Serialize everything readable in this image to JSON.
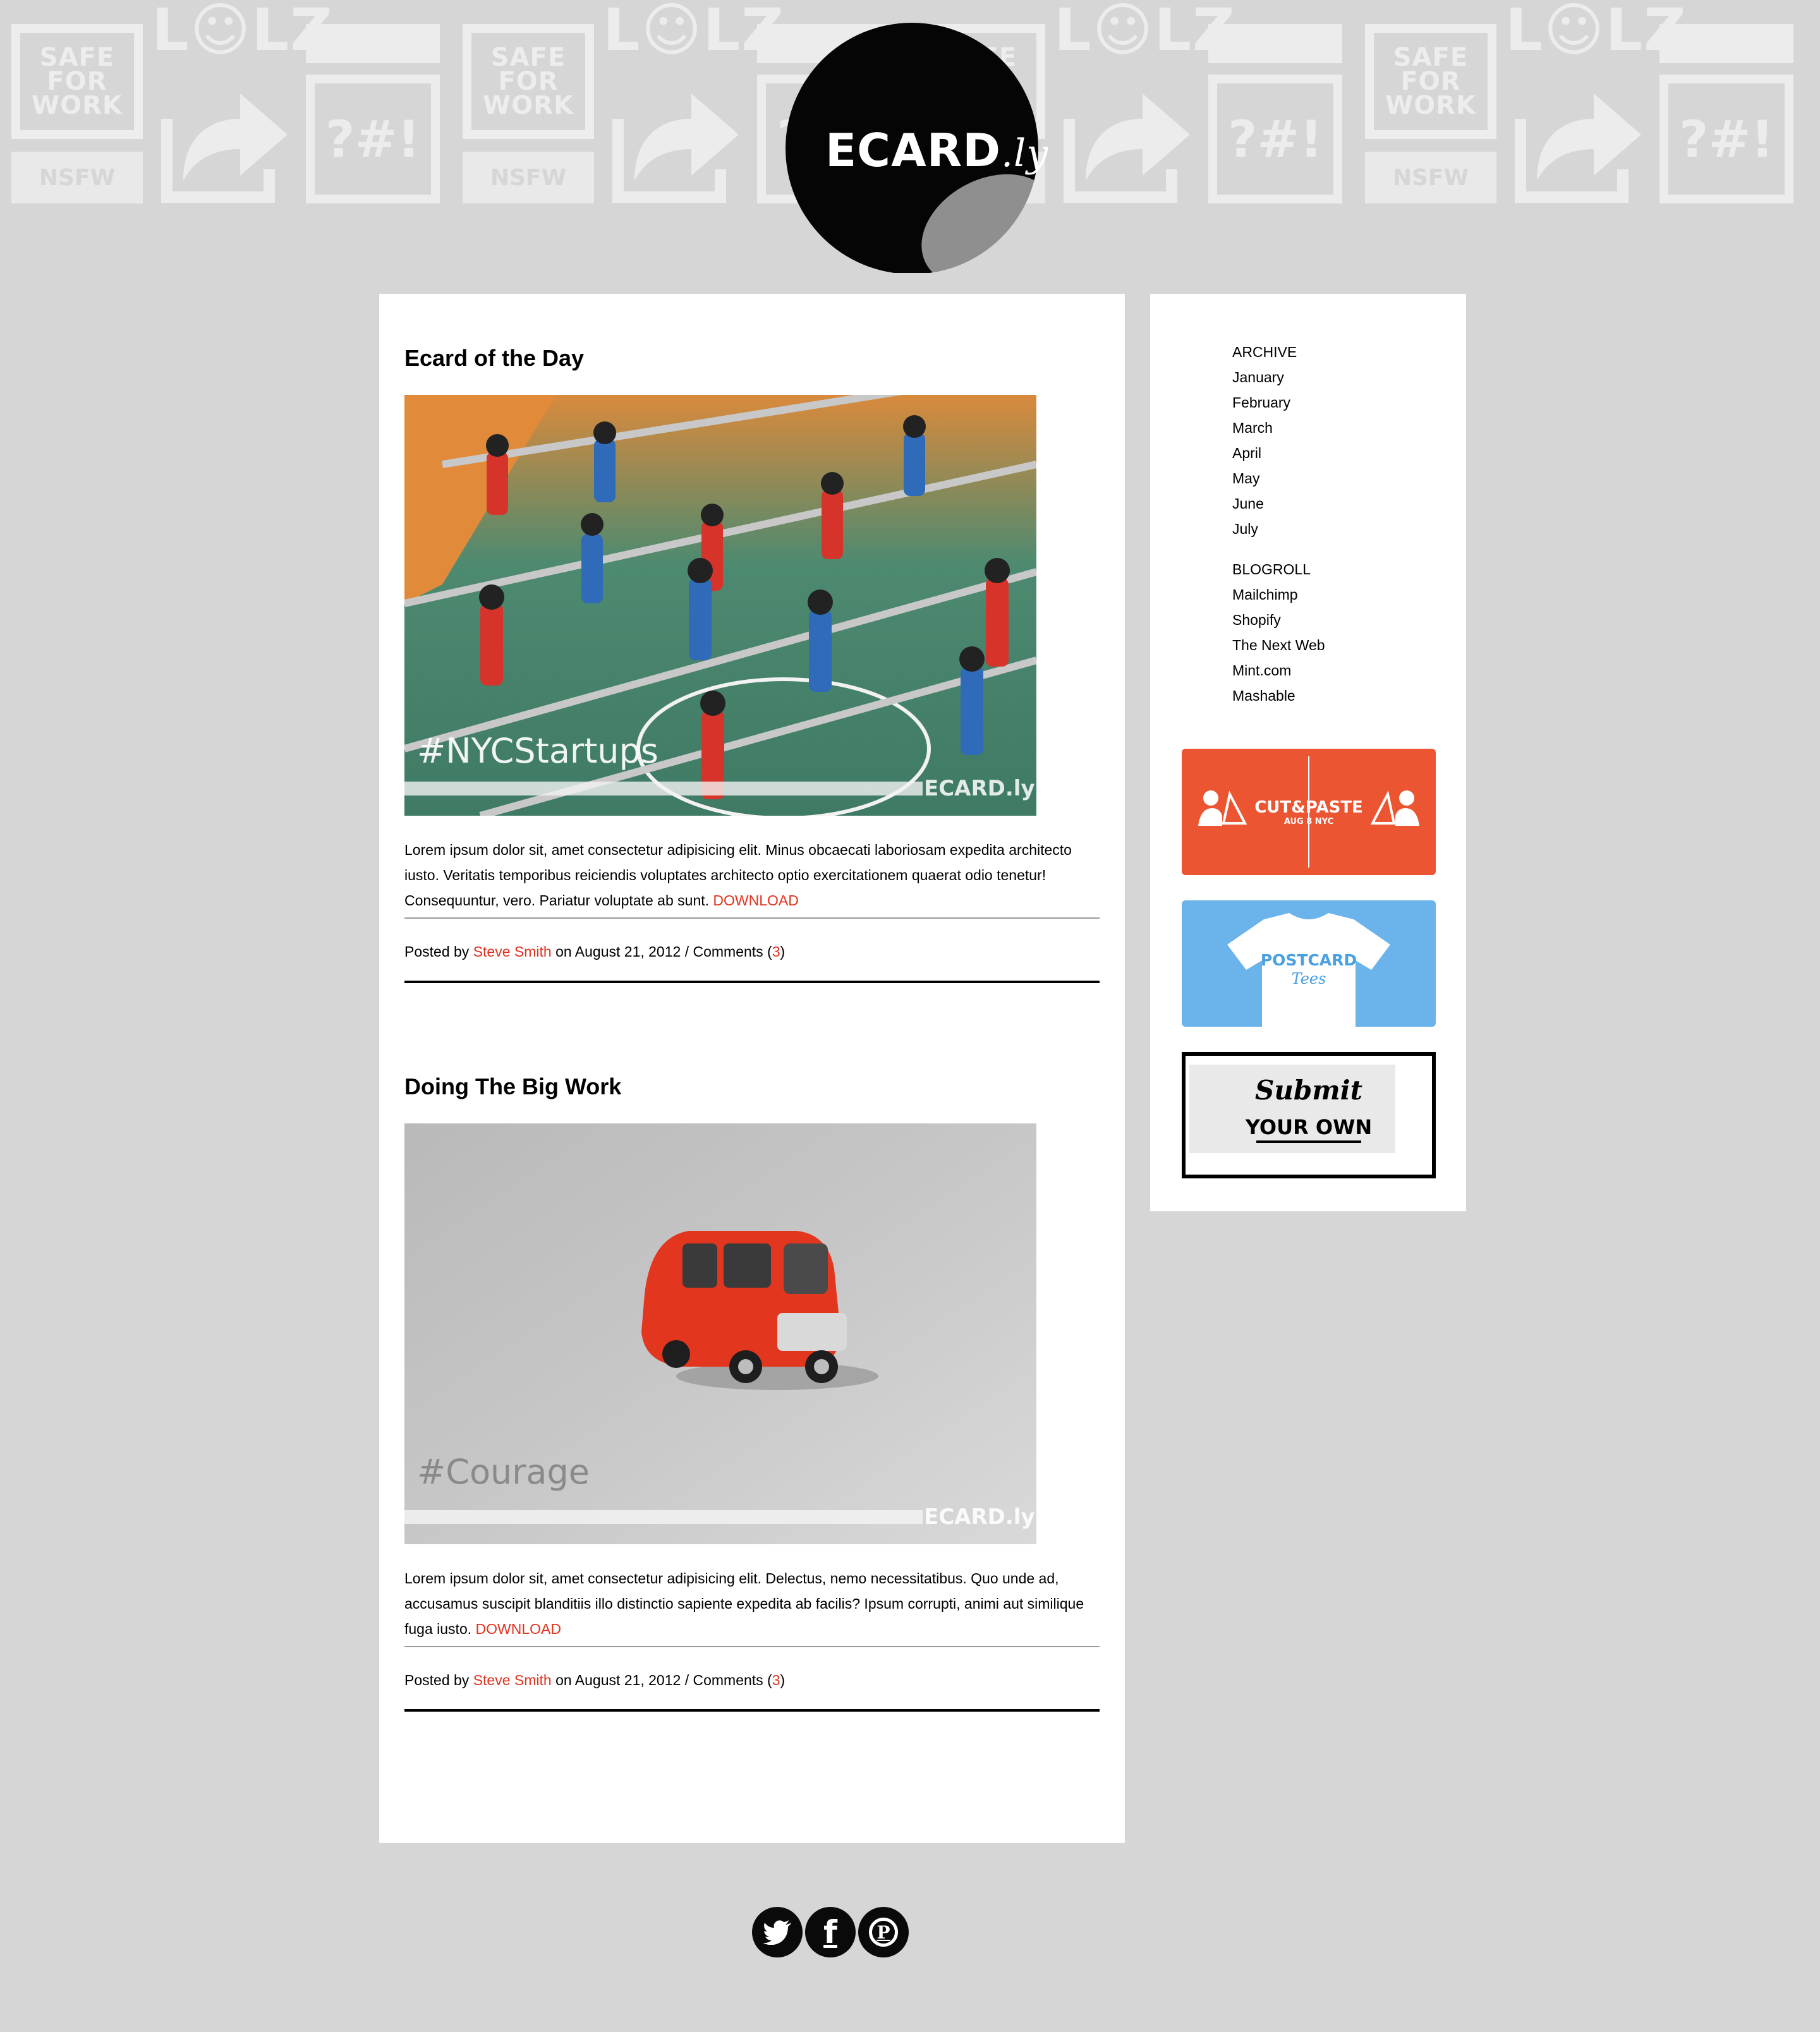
{
  "header": {
    "logo_text": "ECARD",
    "logo_suffix": ".ly",
    "pattern_safe_lines": [
      "SAFE",
      "FOR",
      "WORK"
    ],
    "pattern_nsfw": "NSFW",
    "pattern_lolz": "L☺LZ",
    "pattern_symbols": "?#!"
  },
  "posts": [
    {
      "title": "Ecard of the Day",
      "image_caption": "#NYCStartups",
      "image_watermark": "ECARD.ly",
      "body": "Lorem ipsum dolor sit, amet consectetur adipisicing elit. Minus obcaecati laboriosam expedita architecto iusto. Veritatis temporibus reiciendis voluptates architecto optio exercitationem quaerat odio tenetur! Consequuntur, vero. Pariatur voluptate ab sunt.",
      "download_label": "DOWNLOAD",
      "posted_by_label": "Posted by",
      "author": "Steve Smith",
      "date_text": "on August 21, 2012 / Comments (",
      "comments": "3",
      "close_paren": ")"
    },
    {
      "title": "Doing The Big Work",
      "image_caption": "#Courage",
      "image_watermark": "ECARD.ly",
      "body": "Lorem ipsum dolor sit, amet consectetur adipisicing elit. Delectus, nemo necessitatibus. Quo unde ad, accusamus suscipit blanditiis illo distinctio sapiente expedita ab facilis? Ipsum corrupti, animi aut similique fuga iusto.",
      "download_label": "DOWNLOAD",
      "posted_by_label": "Posted by",
      "author": "Steve Smith",
      "date_text": "on August 21, 2012 / Comments (",
      "comments": "3",
      "close_paren": ")"
    }
  ],
  "sidebar": {
    "archive_heading": "ARCHIVE",
    "archive": [
      "January",
      "February",
      "March",
      "April",
      "May",
      "June",
      "July"
    ],
    "blogroll_heading": "BLOGROLL",
    "blogroll": [
      "Mailchimp",
      "Shopify",
      "The Next Web",
      "Mint.com",
      "Mashable"
    ],
    "ads": {
      "cutpaste_title": "CUT&PASTE",
      "cutpaste_sub": "AUG 8 NYC",
      "postcard_title": "POSTCARD",
      "postcard_sub": "Tees",
      "submit_line1": "Submit",
      "submit_line2": "YOUR OWN"
    }
  },
  "footer": {
    "social": [
      "twitter-icon",
      "facebook-icon",
      "pinterest-icon"
    ],
    "facebook_glyph": "f",
    "pinterest_glyph": "P"
  },
  "colors": {
    "background": "#d6d6d6",
    "accent": "#e0321e",
    "cutpaste": "#ec5532",
    "postcard": "#6ab4eb"
  }
}
